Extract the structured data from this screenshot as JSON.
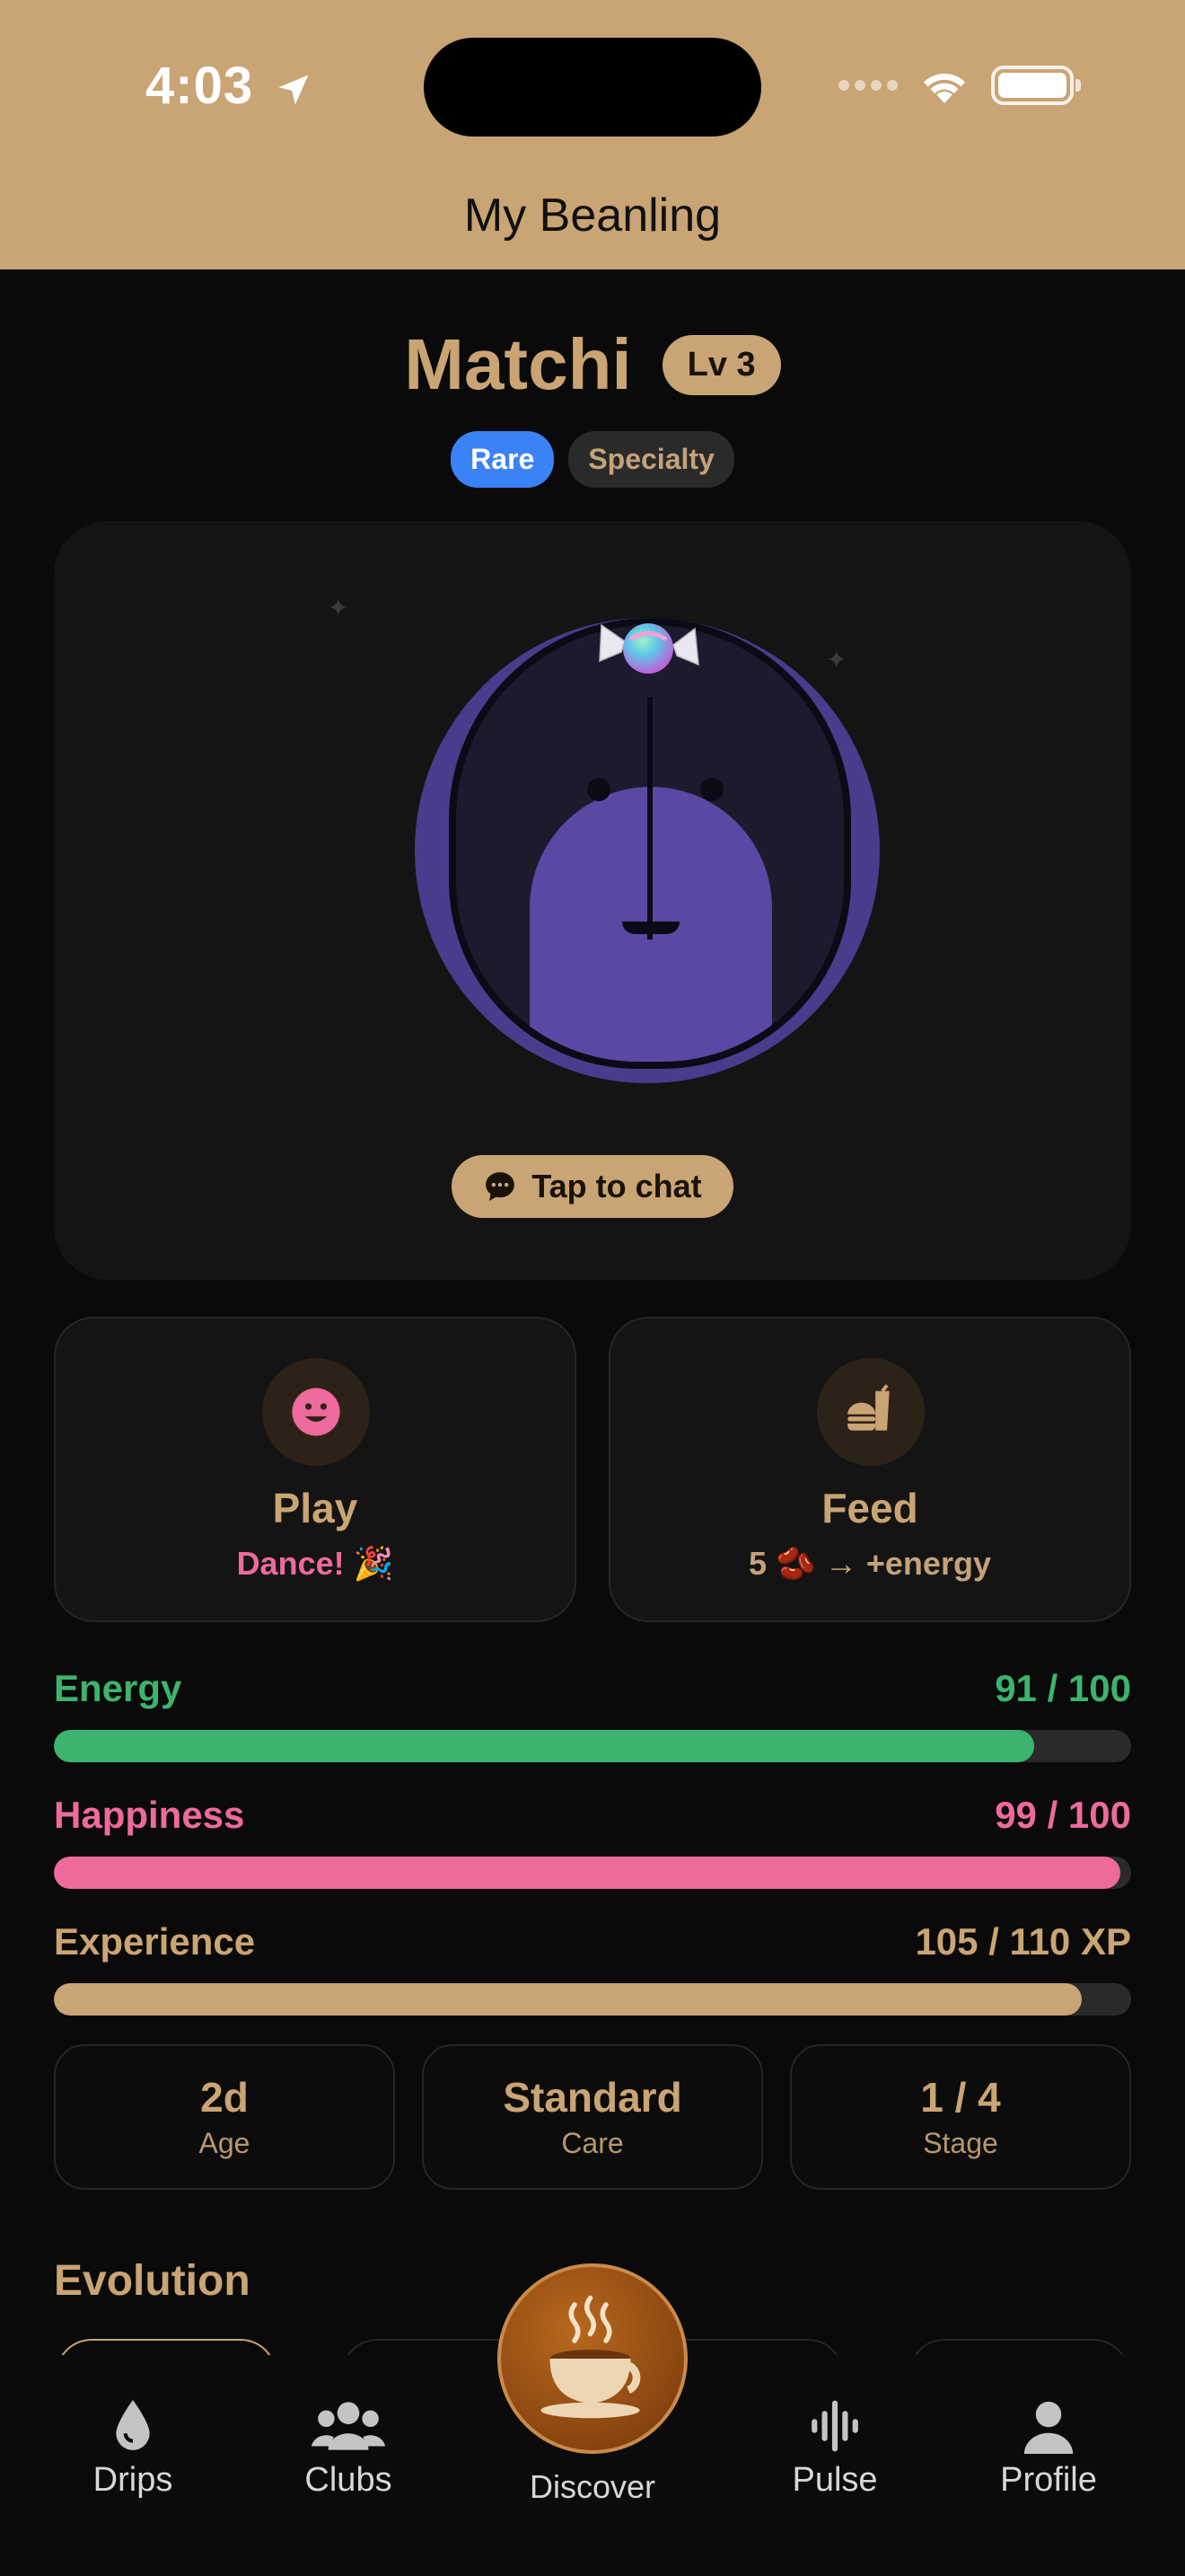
{
  "status_bar": {
    "time": "4:03"
  },
  "header": {
    "title": "My Beanling"
  },
  "pet": {
    "name": "Matchi",
    "level": "Lv 3",
    "tags": [
      "Rare",
      "Specialty"
    ],
    "chat_label": "Tap to chat"
  },
  "actions": {
    "play": {
      "title": "Play",
      "subtitle": "Dance! 🎉"
    },
    "feed": {
      "title": "Feed",
      "subtitle": "5 🫘 → +energy"
    }
  },
  "meters": [
    {
      "label": "Energy",
      "value_text": "91 / 100",
      "fraction": 0.91,
      "color": "#3cb46e"
    },
    {
      "label": "Happiness",
      "value_text": "99 / 100",
      "fraction": 0.99,
      "color": "#ee6a9c"
    },
    {
      "label": "Experience",
      "value_text": "105 / 110 XP",
      "fraction": 0.9545,
      "color": "#c9a474"
    }
  ],
  "info": [
    {
      "value": "2d",
      "label": "Age"
    },
    {
      "value": "Standard",
      "label": "Care"
    },
    {
      "value": "1 / 4",
      "label": "Stage"
    }
  ],
  "evolution_title": "Evolution",
  "tabbar": {
    "drips": "Drips",
    "clubs": "Clubs",
    "discover": "Discover",
    "pulse": "Pulse",
    "profile": "Profile"
  },
  "colors": {
    "accent": "#c9a474",
    "rare": "#3b82f6",
    "play": "#ee6a9c",
    "energy": "#3cb46e"
  }
}
